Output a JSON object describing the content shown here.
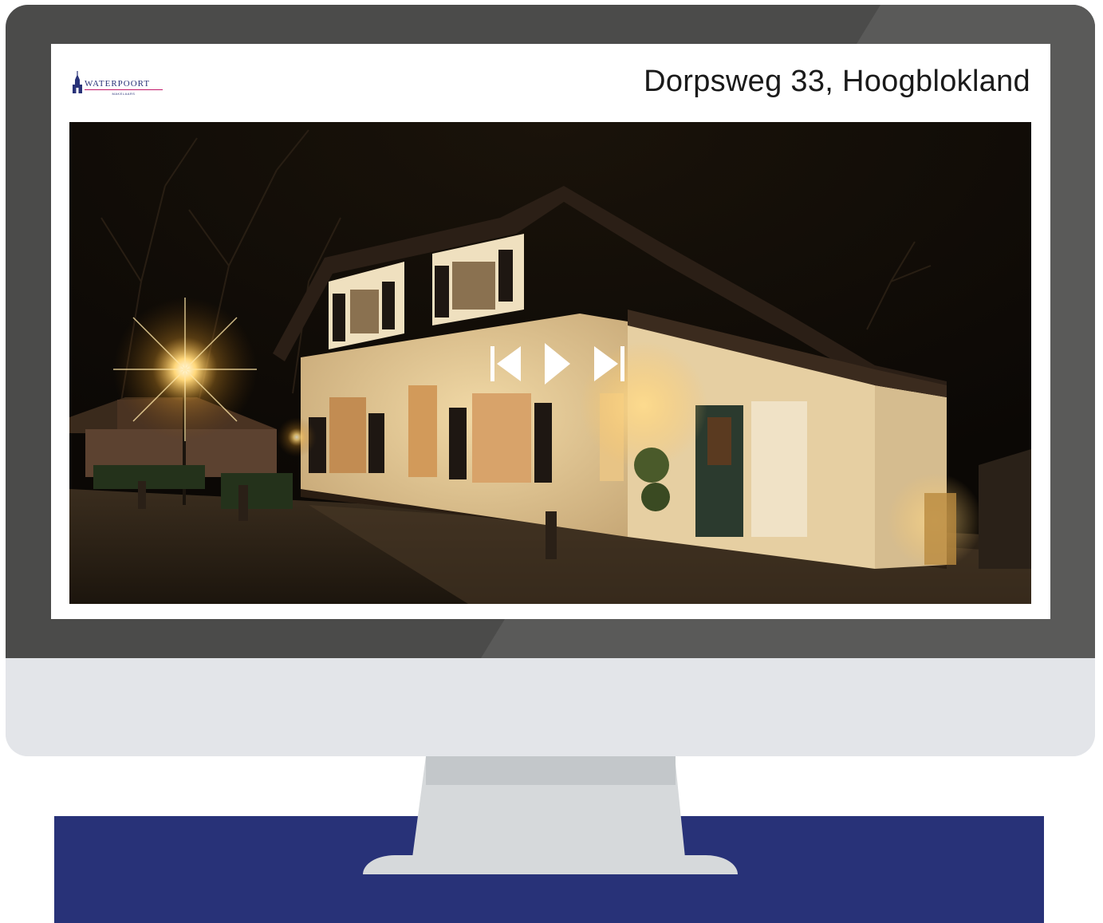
{
  "brand": {
    "name": "WATERPOORT",
    "tagline": "MAKELAARS"
  },
  "listing": {
    "address": "Dorpsweg 33, Hoogblokland"
  },
  "slideshow": {
    "controls": [
      "previous",
      "play",
      "next"
    ]
  },
  "colors": {
    "bezel": "#4b4b4a",
    "chin": "#e3e5e9",
    "stand": "#d6d9db",
    "navy": "#283278",
    "brand_accent": "#c21a6b"
  }
}
